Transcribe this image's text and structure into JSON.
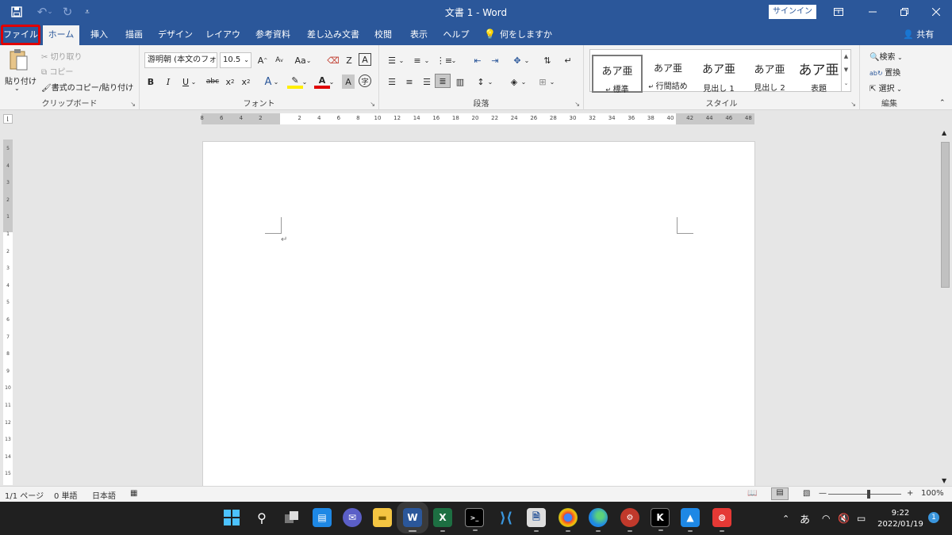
{
  "titlebar": {
    "title": "文書 1  -  Word",
    "signin": "サインイン"
  },
  "tabs": [
    "ファイル",
    "ホーム",
    "挿入",
    "描画",
    "デザイン",
    "レイアウト",
    "参考資料",
    "差し込み文書",
    "校閲",
    "表示",
    "ヘルプ",
    "何をしますか"
  ],
  "share": "共有",
  "clipboard": {
    "paste": "貼り付け",
    "cut": "切り取り",
    "copy": "コピー",
    "format_painter": "書式のコピー/貼り付け",
    "label": "クリップボード"
  },
  "font": {
    "name": "游明朝 (本文のフォ",
    "size": "10.5",
    "label": "フォント",
    "case": "Aa"
  },
  "paragraph": {
    "label": "段落"
  },
  "styles": {
    "label": "スタイル",
    "items": [
      {
        "sample": "あア亜",
        "name": "標準"
      },
      {
        "sample": "あア亜",
        "name": "行間詰め"
      },
      {
        "sample": "あア亜",
        "name": "見出し 1"
      },
      {
        "sample": "あア亜",
        "name": "見出し 2"
      },
      {
        "sample": "あア亜",
        "name": "表題"
      }
    ]
  },
  "editing": {
    "label": "編集",
    "find": "検索",
    "replace": "置換",
    "select": "選択"
  },
  "hruler": {
    "left": [
      "8",
      "6",
      "4",
      "2"
    ],
    "right": [
      "2",
      "4",
      "6",
      "8",
      "10",
      "12",
      "14",
      "16",
      "18",
      "20",
      "22",
      "24",
      "26",
      "28",
      "30",
      "32",
      "34",
      "36",
      "38",
      "40",
      "42",
      "44",
      "46",
      "48"
    ]
  },
  "vruler": [
    "5",
    "4",
    "3",
    "2",
    "1",
    "1",
    "2",
    "3",
    "4",
    "5",
    "6",
    "7",
    "8",
    "9",
    "10",
    "11",
    "12",
    "13",
    "14",
    "15"
  ],
  "document": {
    "paragraph_mark": "↵"
  },
  "status": {
    "page": "1/1 ページ",
    "words": "0 単語",
    "language": "日本語",
    "zoom": "100%"
  },
  "taskbar": {
    "time": "9:22",
    "date": "2022/01/19",
    "ime": "あ",
    "notifications": "1"
  }
}
